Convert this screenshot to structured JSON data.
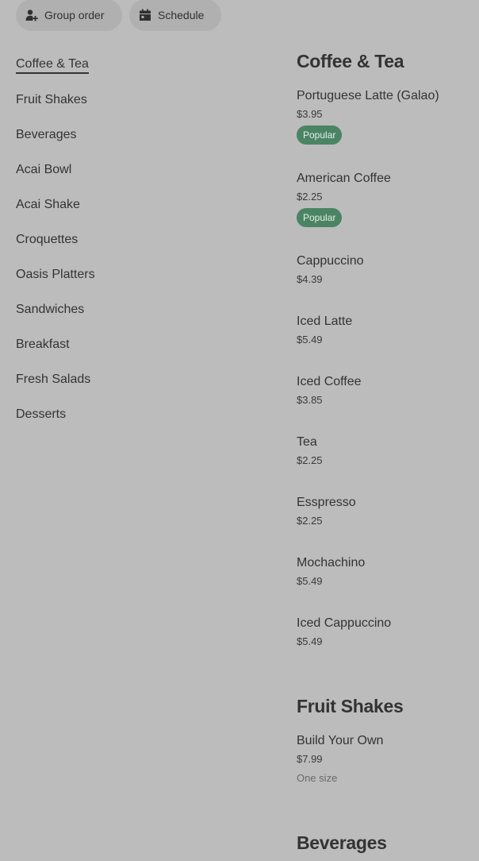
{
  "actions": {
    "group_order": {
      "label": "Group order",
      "icon": "add-person-icon"
    },
    "schedule": {
      "label": "Schedule",
      "icon": "calendar-icon"
    }
  },
  "categories": [
    "Coffee & Tea",
    "Fruit Shakes",
    "Beverages",
    "Acai Bowl",
    "Acai Shake",
    "Croquettes",
    "Oasis Platters",
    "Sandwiches",
    "Breakfast",
    "Fresh Salads",
    "Desserts"
  ],
  "active_category": "Coffee & Tea",
  "sections": [
    {
      "title": "Coffee & Tea",
      "items": [
        {
          "name": "Portuguese Latte (Galao)",
          "price": "$3.95",
          "badge": "Popular"
        },
        {
          "name": "American Coffee",
          "price": "$2.25",
          "badge": "Popular"
        },
        {
          "name": "Cappuccino",
          "price": "$4.39"
        },
        {
          "name": "Iced Latte",
          "price": "$5.49"
        },
        {
          "name": "Iced Coffee",
          "price": "$3.85"
        },
        {
          "name": "Tea",
          "price": "$2.25"
        },
        {
          "name": "Esspresso",
          "price": "$2.25"
        },
        {
          "name": "Mochachino",
          "price": "$5.49"
        },
        {
          "name": "Iced Cappuccino",
          "price": "$5.49"
        }
      ]
    },
    {
      "title": "Fruit Shakes",
      "items": [
        {
          "name": "Build Your Own",
          "price": "$7.99",
          "size": "One size"
        }
      ]
    },
    {
      "title": "Beverages",
      "items": []
    }
  ],
  "colors": {
    "badge_bg": "#4a8464",
    "page_bg": "#bcbcbc"
  }
}
